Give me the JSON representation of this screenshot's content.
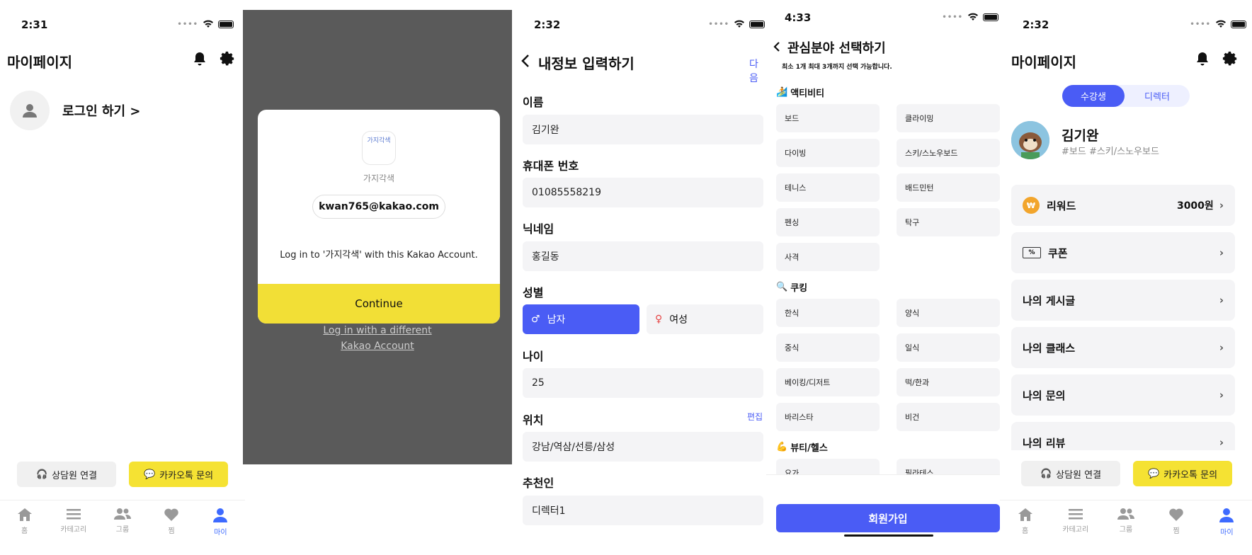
{
  "s1": {
    "time": "2:31",
    "title": "마이페이지",
    "login_label": "로그인 하기 >",
    "consult_label": "상담원 연결",
    "kakao_label": "카카오톡 문의",
    "tabs": [
      "홈",
      "카테고리",
      "그룹",
      "찜",
      "마이"
    ]
  },
  "s2": {
    "app_logo_text": "가지각색",
    "app_name": "가지각색",
    "email": "kwan765@kakao.com",
    "message": "Log in to '가지각색' with this Kakao Account.",
    "continue_label": "Continue",
    "different_account_label": "Log in with a different Kakao Account"
  },
  "s3": {
    "time": "2:32",
    "title": "내정보 입력하기",
    "next_label": "다음",
    "name_label": "이름",
    "name_value": "김기완",
    "phone_label": "휴대폰 번호",
    "phone_value": "01085558219",
    "nickname_label": "닉네임",
    "nickname_value": "홍길동",
    "gender_label": "성별",
    "male_label": "남자",
    "female_label": "여성",
    "age_label": "나이",
    "age_value": "25",
    "location_label": "위치",
    "edit_label": "편집",
    "location_value": "강남/역삼/선릉/삼성",
    "referrer_label": "추천인",
    "referrer_value": "디렉터1"
  },
  "s4": {
    "time": "4:33",
    "title": "관심분야 선택하기",
    "subtitle": "최소 1개 최대 3개까지 선택 가능합니다.",
    "sections": [
      {
        "label": "액티비티",
        "icon": "🏄",
        "items": [
          "보드",
          "클라이밍",
          "다이빙",
          "스키/스노우보드",
          "테니스",
          "배드민턴",
          "펜싱",
          "탁구",
          "사격"
        ]
      },
      {
        "label": "쿠킹",
        "icon": "🔍",
        "items": [
          "한식",
          "양식",
          "중식",
          "일식",
          "베이킹/디저트",
          "떡/한과",
          "바리스타",
          "비건"
        ]
      },
      {
        "label": "뷰티/헬스",
        "icon": "💪",
        "items": [
          "요가",
          "필라테스"
        ]
      }
    ],
    "signup_label": "회원가입"
  },
  "s5": {
    "time": "2:32",
    "title": "마이페이지",
    "toggle": [
      "수강생",
      "디렉터"
    ],
    "user_name": "김기완",
    "user_tags": "#보드 #스키/스노우보드",
    "reward_label": "리워드",
    "reward_value": "3000원",
    "coupon_label": "쿠폰",
    "menu": [
      "나의 게시글",
      "나의 클래스",
      "나의 문의",
      "나의 리뷰"
    ],
    "consult_label": "상담원 연결",
    "kakao_label": "카카오톡 문의",
    "tabs": [
      "홈",
      "카테고리",
      "그룹",
      "찜",
      "마이"
    ]
  },
  "colors": {
    "accent": "#4a5cf5",
    "kakao_yellow": "#f5e233",
    "overlay": "#5a5a5a"
  }
}
